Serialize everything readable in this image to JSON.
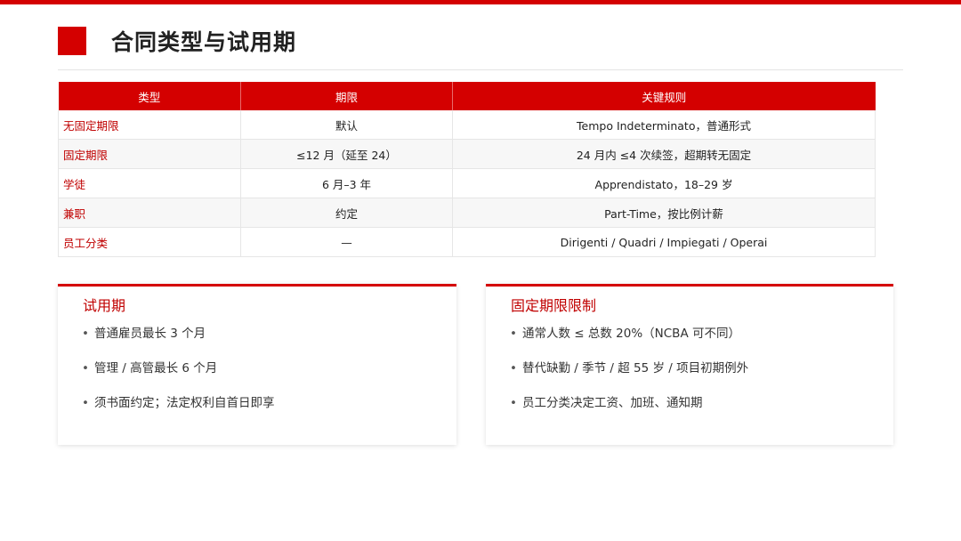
{
  "title": "合同类型与试用期",
  "table": {
    "headers": [
      "类型",
      "期限",
      "关键规则"
    ],
    "rows": [
      [
        "无固定期限",
        "默认",
        "Tempo Indeterminato，普通形式"
      ],
      [
        "固定期限",
        "≤12 月（延至 24）",
        "24 月内 ≤4 次续签，超期转无固定"
      ],
      [
        "学徒",
        "6 月–3 年",
        "Apprendistato，18–29 岁"
      ],
      [
        "兼职",
        "约定",
        "Part-Time，按比例计薪"
      ],
      [
        "员工分类",
        "—",
        "Dirigenti / Quadri / Impiegati / Operai"
      ]
    ]
  },
  "cards": [
    {
      "title": "试用期",
      "items": [
        "普通雇员最长 3 个月",
        "管理 / 高管最长 6 个月",
        "须书面约定；法定权利自首日即享"
      ]
    },
    {
      "title": "固定期限限制",
      "items": [
        "通常人数 ≤ 总数 20%（NCBA 可不同）",
        "替代缺勤 / 季节 / 超 55 岁 / 项目初期例外",
        "员工分类决定工资、加班、通知期"
      ]
    }
  ],
  "colors": {
    "accent": "#d40000",
    "accent_text": "#c00000"
  }
}
